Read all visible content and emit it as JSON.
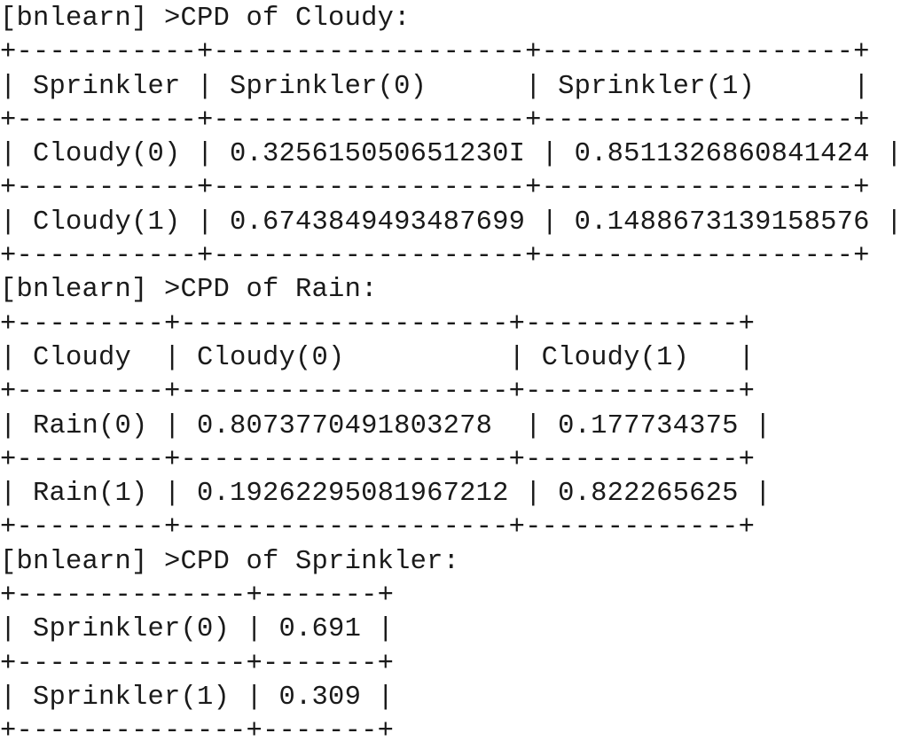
{
  "output": {
    "lines": [
      "[bnlearn] >CPD of Cloudy:",
      "+-----------+-------------------+-------------------+",
      "| Sprinkler | Sprinkler(0)      | Sprinkler(1)      |",
      "+-----------+-------------------+-------------------+",
      "| Cloudy(0) | 0.325615050651230I | 0.8511326860841424 |",
      "+-----------+-------------------+-------------------+",
      "| Cloudy(1) | 0.6743849493487699 | 0.1488673139158576 |",
      "+-----------+-------------------+-------------------+",
      "[bnlearn] >CPD of Rain:",
      "+---------+--------------------+-------------+",
      "| Cloudy  | Cloudy(0)          | Cloudy(1)   |",
      "+---------+--------------------+-------------+",
      "| Rain(0) | 0.8073770491803278  | 0.177734375 |",
      "+---------+--------------------+-------------+",
      "| Rain(1) | 0.19262295081967212 | 0.822265625 |",
      "+---------+--------------------+-------------+",
      "[bnlearn] >CPD of Sprinkler:",
      "+--------------+-------+",
      "| Sprinkler(0) | 0.691 |",
      "+--------------+-------+",
      "| Sprinkler(1) | 0.309 |",
      "+--------------+-------+"
    ]
  }
}
